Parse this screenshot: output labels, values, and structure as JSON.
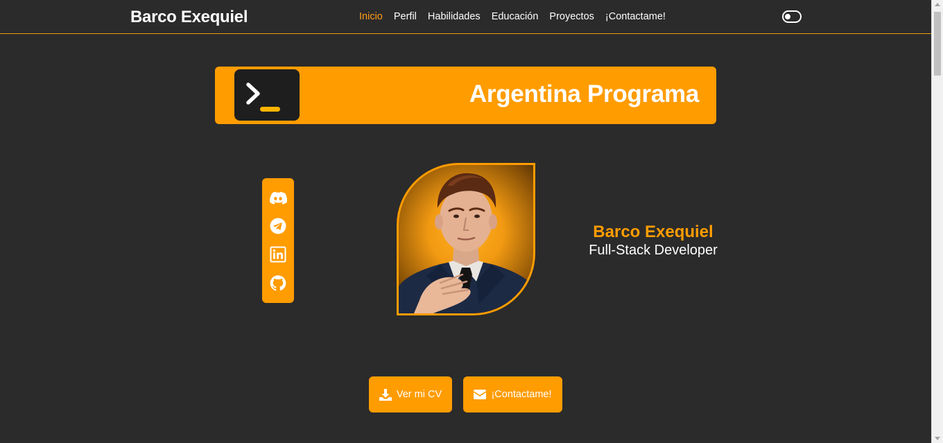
{
  "header": {
    "brand": "Barco Exequiel",
    "nav": [
      {
        "label": "Inicio",
        "active": true
      },
      {
        "label": "Perfil",
        "active": false
      },
      {
        "label": "Habilidades",
        "active": false
      },
      {
        "label": "Educación",
        "active": false
      },
      {
        "label": "Proyectos",
        "active": false
      },
      {
        "label": "¡Contactame!",
        "active": false
      }
    ],
    "theme_toggle_icon": "toggle-icon"
  },
  "banner": {
    "title": "Argentina Programa",
    "logo_icon": "terminal-icon"
  },
  "social": [
    {
      "icon": "discord-icon"
    },
    {
      "icon": "telegram-icon"
    },
    {
      "icon": "linkedin-icon"
    },
    {
      "icon": "github-icon"
    }
  ],
  "profile": {
    "name": "Barco Exequiel",
    "role": "Full-Stack Developer"
  },
  "buttons": {
    "cv_label": "Ver mi CV",
    "cv_icon": "download-icon",
    "contact_label": "¡Contactame!",
    "contact_icon": "envelope-icon"
  },
  "colors": {
    "accent": "#ff9c00",
    "background": "#2b2b2b",
    "text": "#ffffff"
  }
}
